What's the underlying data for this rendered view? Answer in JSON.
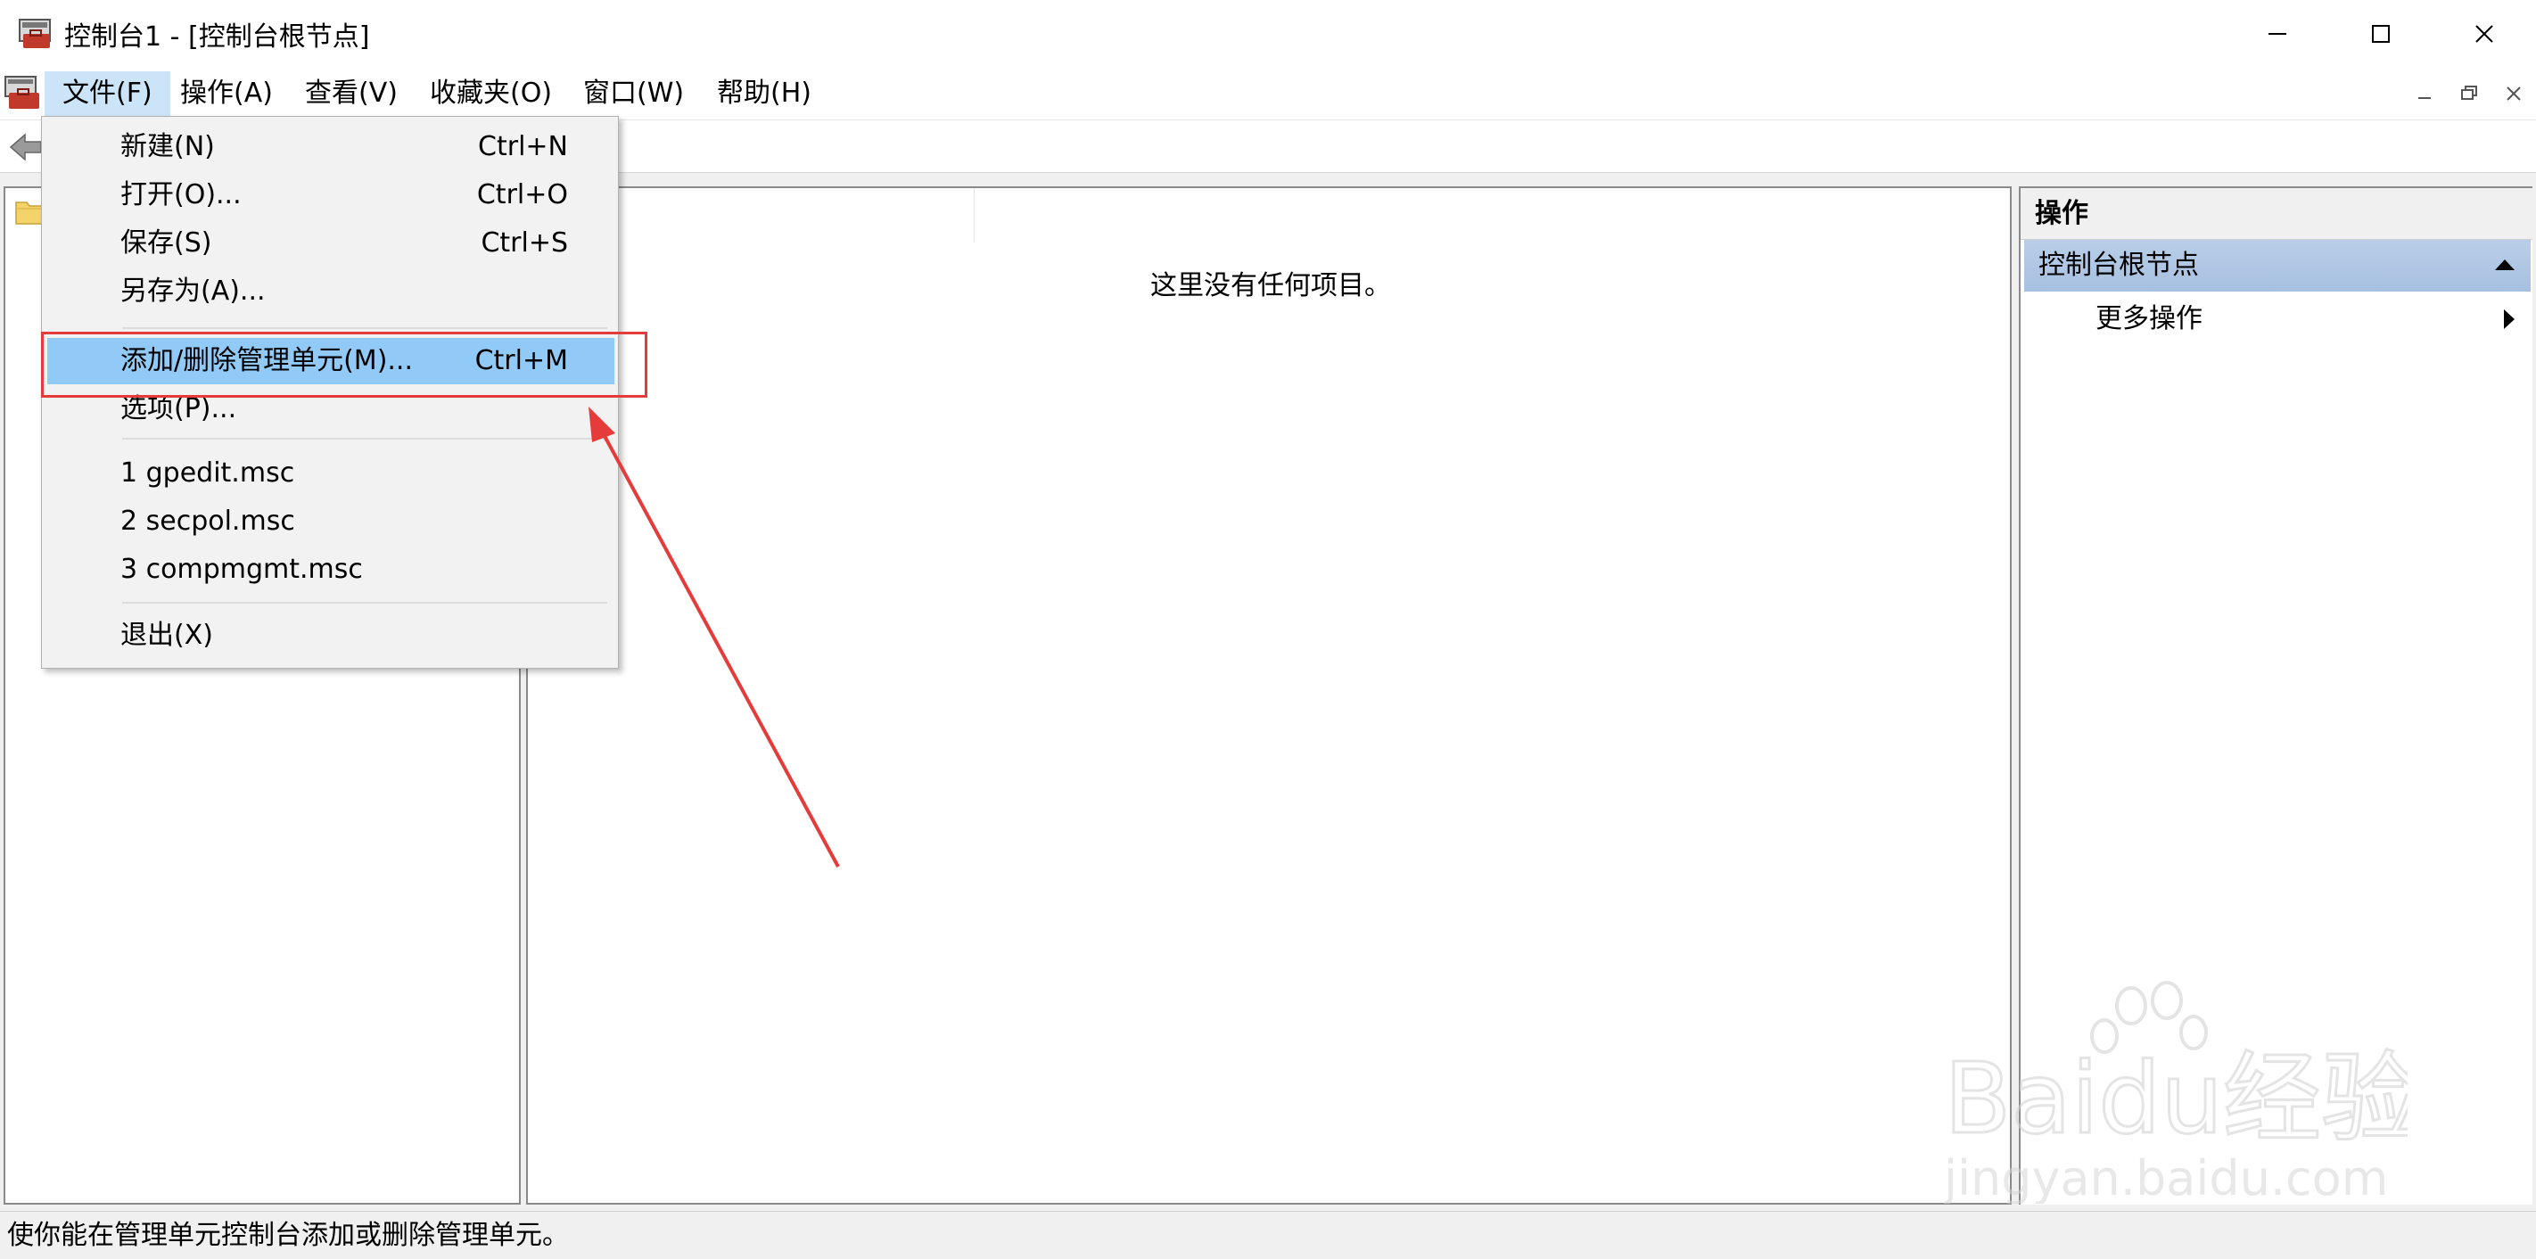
{
  "window": {
    "title": "控制台1 - [控制台根节点]"
  },
  "menubar": {
    "items": [
      {
        "label": "文件(F)"
      },
      {
        "label": "操作(A)"
      },
      {
        "label": "查看(V)"
      },
      {
        "label": "收藏夹(O)"
      },
      {
        "label": "窗口(W)"
      },
      {
        "label": "帮助(H)"
      }
    ]
  },
  "file_menu": {
    "items": [
      {
        "label": "新建(N)",
        "shortcut": "Ctrl+N"
      },
      {
        "label": "打开(O)...",
        "shortcut": "Ctrl+O"
      },
      {
        "label": "保存(S)",
        "shortcut": "Ctrl+S"
      },
      {
        "label": "另存为(A)...",
        "shortcut": ""
      },
      {
        "label": "添加/删除管理单元(M)...",
        "shortcut": "Ctrl+M"
      },
      {
        "label": "选项(P)...",
        "shortcut": ""
      },
      {
        "label": "1 gpedit.msc",
        "shortcut": ""
      },
      {
        "label": "2 secpol.msc",
        "shortcut": ""
      },
      {
        "label": "3 compmgmt.msc",
        "shortcut": ""
      },
      {
        "label": "退出(X)",
        "shortcut": ""
      }
    ],
    "highlighted": "添加/删除管理单元(M)..."
  },
  "result_pane": {
    "empty_message": "这里没有任何项目。"
  },
  "actions_pane": {
    "header": "操作",
    "node": "控制台根节点",
    "more": "更多操作"
  },
  "statusbar": {
    "text": "使你能在管理单元控制台添加或删除管理单元。"
  },
  "watermark": {
    "brand": "Baidu经验",
    "url": "jingyan.baidu.com"
  },
  "colors": {
    "highlight_item": "#91c9f7",
    "annotation_red": "#e63b3b",
    "actions_node_bg": "#a6c0e0"
  }
}
